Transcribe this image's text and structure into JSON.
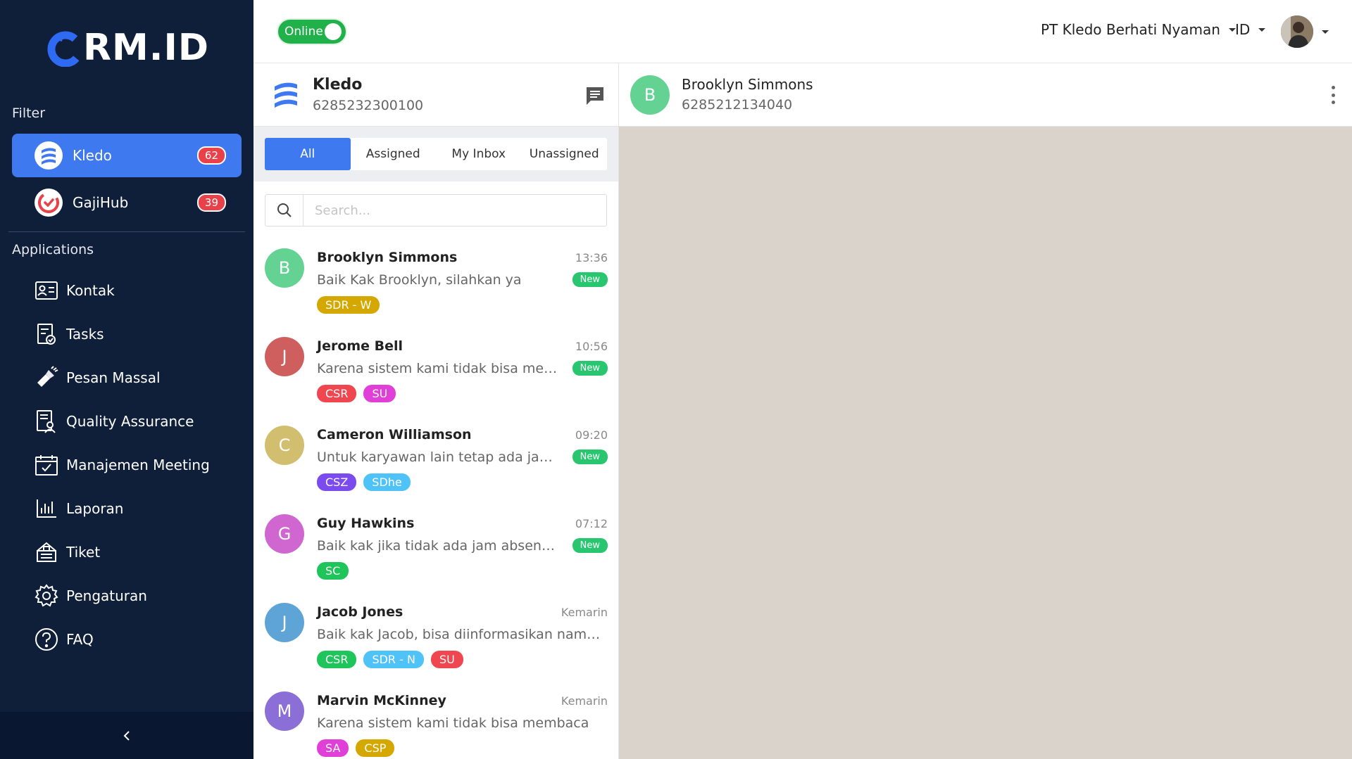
{
  "brand": {
    "logo_text": "RM.ID"
  },
  "sidebar": {
    "filter_label": "Filter",
    "channels": [
      {
        "name": "Kledo",
        "badge": "62",
        "active": true
      },
      {
        "name": "GajiHub",
        "badge": "39",
        "active": false
      }
    ],
    "applications_label": "Applications",
    "nav": [
      {
        "label": "Kontak",
        "icon": "contact-card-icon"
      },
      {
        "label": "Tasks",
        "icon": "tasks-icon"
      },
      {
        "label": "Pesan Massal",
        "icon": "broadcast-icon"
      },
      {
        "label": "Quality Assurance",
        "icon": "quality-assurance-icon"
      },
      {
        "label": "Manajemen Meeting",
        "icon": "calendar-icon"
      },
      {
        "label": "Laporan",
        "icon": "bar-chart-icon"
      },
      {
        "label": "Tiket",
        "icon": "ticket-icon"
      },
      {
        "label": "Pengaturan",
        "icon": "gear-icon"
      },
      {
        "label": "FAQ",
        "icon": "help-icon"
      }
    ],
    "collapse_icon": "chevron-left-icon"
  },
  "topbar": {
    "status_label": "Online",
    "status_on": true,
    "company": "PT Kledo Berhati Nyaman",
    "language": "ID"
  },
  "inbox": {
    "name": "Kledo",
    "phone": "6285232300100",
    "tabs": [
      "All",
      "Assigned",
      "My Inbox",
      "Unassigned"
    ],
    "active_tab": "All",
    "search_placeholder": "Search...",
    "conversations": [
      {
        "initial": "B",
        "name": "Brooklyn Simmons",
        "time": "13:36",
        "message": "Baik Kak Brooklyn, silahkan ya",
        "new_label": "New",
        "avatar_color": "#63d293",
        "tags": [
          {
            "label": "SDR - W",
            "color": "#d4a800"
          }
        ]
      },
      {
        "initial": "J",
        "name": "Jerome Bell",
        "time": "10:56",
        "message": "Karena sistem kami tidak bisa membaca",
        "new_label": "New",
        "avatar_color": "#cf5f5f",
        "tags": [
          {
            "label": "CSR",
            "color": "#f0464f"
          },
          {
            "label": "SU",
            "color": "#e040d8"
          }
        ]
      },
      {
        "initial": "C",
        "name": "Cameron Williamson",
        "time": "09:20",
        "message": "Untuk karyawan lain tetap ada jadwal kerja",
        "new_label": "New",
        "avatar_color": "#d1be6e",
        "tags": [
          {
            "label": "CSZ",
            "color": "#7b4bf0"
          },
          {
            "label": "SDhe",
            "color": "#4fc3f7"
          }
        ]
      },
      {
        "initial": "G",
        "name": "Guy Hawkins",
        "time": "07:12",
        "message": "Baik kak jika tidak ada jam absensinya",
        "new_label": "New",
        "avatar_color": "#d066d0",
        "tags": [
          {
            "label": "SC",
            "color": "#1fc45a"
          }
        ]
      },
      {
        "initial": "J",
        "name": "Jacob Jones",
        "time": "Kemarin",
        "message": "Baik kak Jacob, bisa diinformasikan nama perusahaan",
        "new_label": "",
        "avatar_color": "#5ea4d6",
        "tags": [
          {
            "label": "CSR",
            "color": "#1fc45a"
          },
          {
            "label": "SDR - N",
            "color": "#4fc3f7"
          },
          {
            "label": "SU",
            "color": "#f0464f"
          }
        ]
      },
      {
        "initial": "M",
        "name": "Marvin McKinney",
        "time": "Kemarin",
        "message": "Karena sistem kami tidak bisa membaca",
        "new_label": "",
        "avatar_color": "#8b6fd6",
        "tags": [
          {
            "label": "SA",
            "color": "#e040d8"
          },
          {
            "label": "CSP",
            "color": "#d4a800"
          }
        ]
      }
    ]
  },
  "chat": {
    "initial": "B",
    "name": "Brooklyn Simmons",
    "phone": "6285212134040"
  }
}
